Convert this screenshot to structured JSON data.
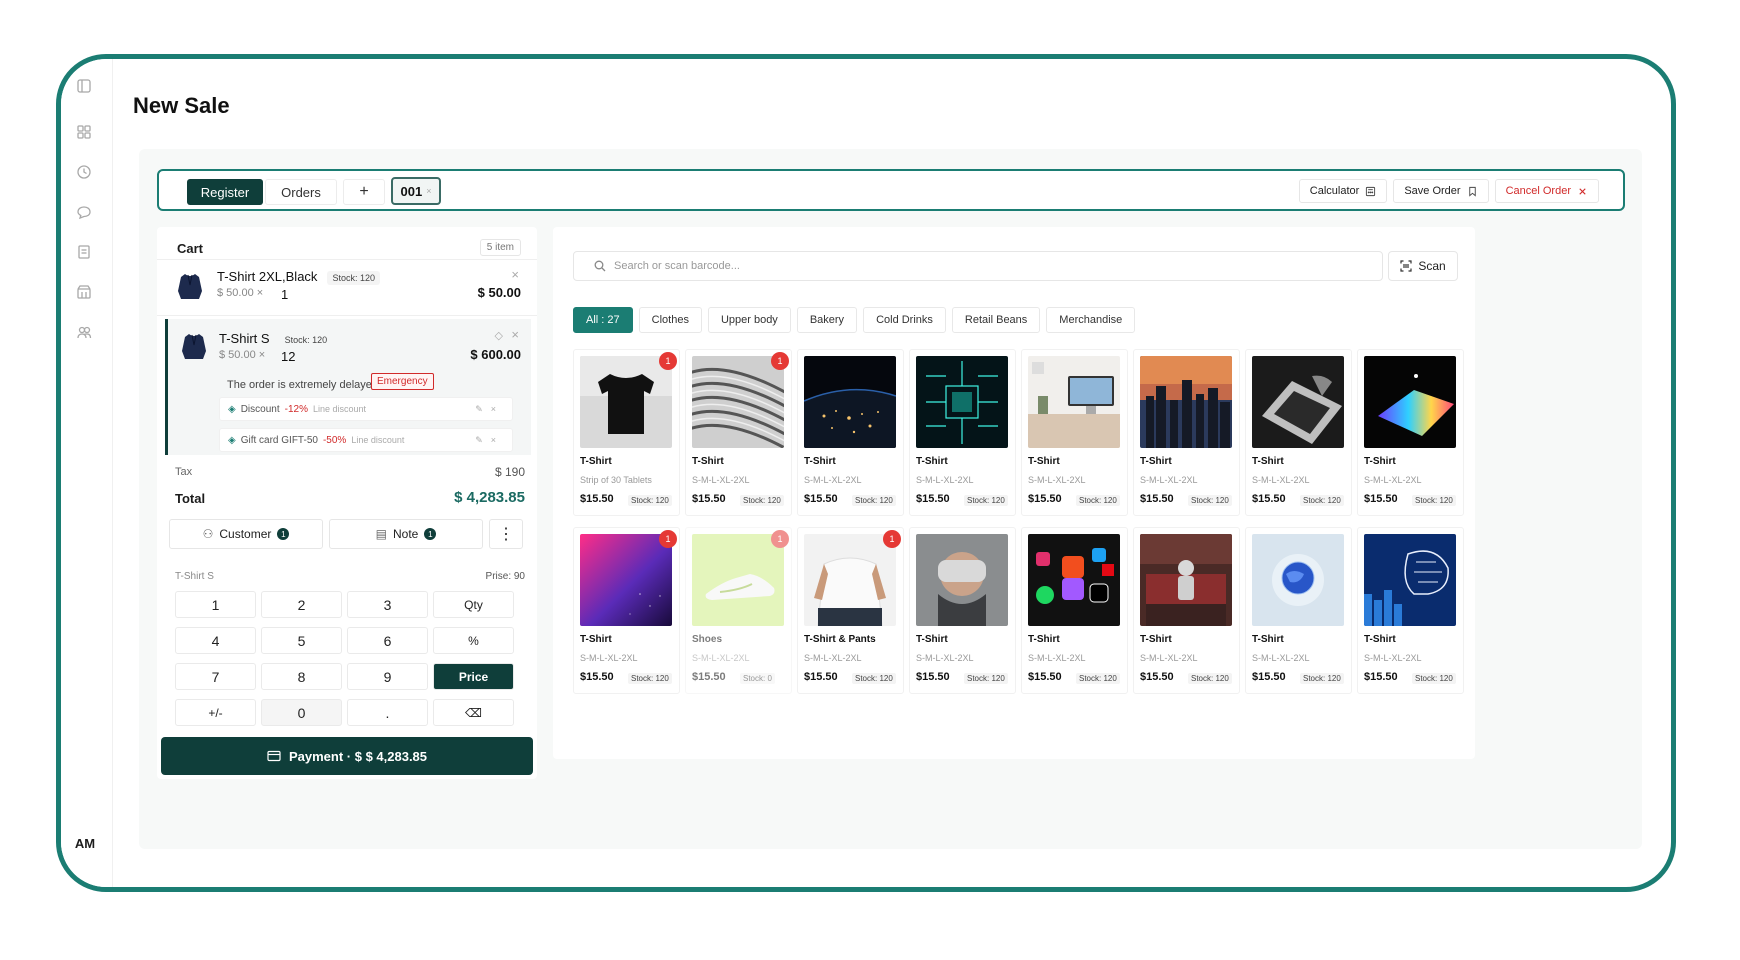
{
  "page": {
    "title": "New Sale",
    "user_initials": "AM"
  },
  "rail": {
    "icons": [
      "sidebar-toggle-icon",
      "grid-icon",
      "clock-icon",
      "chat-icon",
      "document-icon",
      "store-icon",
      "users-icon"
    ]
  },
  "tabbar": {
    "register": "Register",
    "orders": "Orders",
    "plus": "+",
    "order_tab": "001",
    "order_tab_close": "×",
    "calculator": "Calculator",
    "save_order": "Save Order",
    "cancel_order": "Cancel Order"
  },
  "cart": {
    "title": "Cart",
    "count": "5 item",
    "items": [
      {
        "name": "T-Shirt 2XL,Black",
        "stock": "Stock: 120",
        "unit": "$ 50.00 ×",
        "qty": "1",
        "total": "$ 50.00"
      },
      {
        "name": "T-Shirt S",
        "stock": "Stock: 120",
        "unit": "$ 50.00 ×",
        "qty": "12",
        "total": "$ 600.00",
        "note": "The order is extremely delayed",
        "tag": "Emergency",
        "discounts": [
          {
            "label": "Discount",
            "pct": "-12%",
            "sub": "Line discount"
          },
          {
            "label": "Gift card GIFT-50",
            "pct": "-50%",
            "sub": "Line discount"
          }
        ]
      }
    ],
    "tax_label": "Tax",
    "tax_value": "$ 190",
    "total_label": "Total",
    "total_value": "$ 4,283.85",
    "customer": "Customer",
    "customer_count": "1",
    "note": "Note",
    "note_count": "1",
    "selected_label": "T-Shirt S",
    "selected_price": "Prise: 90",
    "keys": [
      "1",
      "2",
      "3",
      "Qty",
      "4",
      "5",
      "6",
      "%",
      "7",
      "8",
      "9",
      "Price",
      "+/-",
      "0",
      ".",
      "⌫"
    ],
    "payment": "Payment · $ $ 4,283.85"
  },
  "products": {
    "search_placeholder": "Search or scan barcode...",
    "scan": "Scan",
    "categories": [
      "All : 27",
      "Clothes",
      "Upper body",
      "Bakery",
      "Cold Drinks",
      "Retail Beans",
      "Merchandise"
    ],
    "cards": [
      {
        "name": "T-Shirt",
        "variant": "Strip of 30 Tablets",
        "price": "$15.50",
        "stock": "Stock: 120",
        "badge": "1",
        "art": "tshirt"
      },
      {
        "name": "T-Shirt",
        "variant": "S-M-L-XL-2XL",
        "price": "$15.50",
        "stock": "Stock: 120",
        "badge": "1",
        "art": "wave"
      },
      {
        "name": "T-Shirt",
        "variant": "S-M-L-XL-2XL",
        "price": "$15.50",
        "stock": "Stock: 120",
        "badge": "",
        "art": "earth"
      },
      {
        "name": "T-Shirt",
        "variant": "S-M-L-XL-2XL",
        "price": "$15.50",
        "stock": "Stock: 120",
        "badge": "",
        "art": "circuit"
      },
      {
        "name": "T-Shirt",
        "variant": "S-M-L-XL-2XL",
        "price": "$15.50",
        "stock": "Stock: 120",
        "badge": "",
        "art": "desk"
      },
      {
        "name": "T-Shirt",
        "variant": "S-M-L-XL-2XL",
        "price": "$15.50",
        "stock": "Stock: 120",
        "badge": "",
        "art": "city"
      },
      {
        "name": "T-Shirt",
        "variant": "S-M-L-XL-2XL",
        "price": "$15.50",
        "stock": "Stock: 120",
        "badge": "",
        "art": "laptop"
      },
      {
        "name": "T-Shirt",
        "variant": "S-M-L-XL-2XL",
        "price": "$15.50",
        "stock": "Stock: 120",
        "badge": "",
        "art": "rainbow"
      },
      {
        "name": "T-Shirt",
        "variant": "S-M-L-XL-2XL",
        "price": "$15.50",
        "stock": "Stock: 120",
        "badge": "1",
        "art": "nebula"
      },
      {
        "name": "Shoes",
        "variant": "S-M-L-XL-2XL",
        "price": "$15.50",
        "stock": "Stock: 0",
        "badge": "1",
        "art": "shoe",
        "disabled": true
      },
      {
        "name": "T-Shirt & Pants",
        "variant": "S-M-L-XL-2XL",
        "price": "$15.50",
        "stock": "Stock: 120",
        "badge": "1",
        "art": "man"
      },
      {
        "name": "T-Shirt",
        "variant": "S-M-L-XL-2XL",
        "price": "$15.50",
        "stock": "Stock: 120",
        "badge": "",
        "art": "vr"
      },
      {
        "name": "T-Shirt",
        "variant": "S-M-L-XL-2XL",
        "price": "$15.50",
        "stock": "Stock: 120",
        "badge": "",
        "art": "apps"
      },
      {
        "name": "T-Shirt",
        "variant": "S-M-L-XL-2XL",
        "price": "$15.50",
        "stock": "Stock: 120",
        "badge": "",
        "art": "robot"
      },
      {
        "name": "T-Shirt",
        "variant": "S-M-L-XL-2XL",
        "price": "$15.50",
        "stock": "Stock: 120",
        "badge": "",
        "art": "globe"
      },
      {
        "name": "T-Shirt",
        "variant": "S-M-L-XL-2XL",
        "price": "$15.50",
        "stock": "Stock: 120",
        "badge": "",
        "art": "brain"
      }
    ]
  },
  "colors": {
    "accent": "#1b7d73",
    "dark": "#0f3e3a",
    "danger": "#e53935"
  }
}
